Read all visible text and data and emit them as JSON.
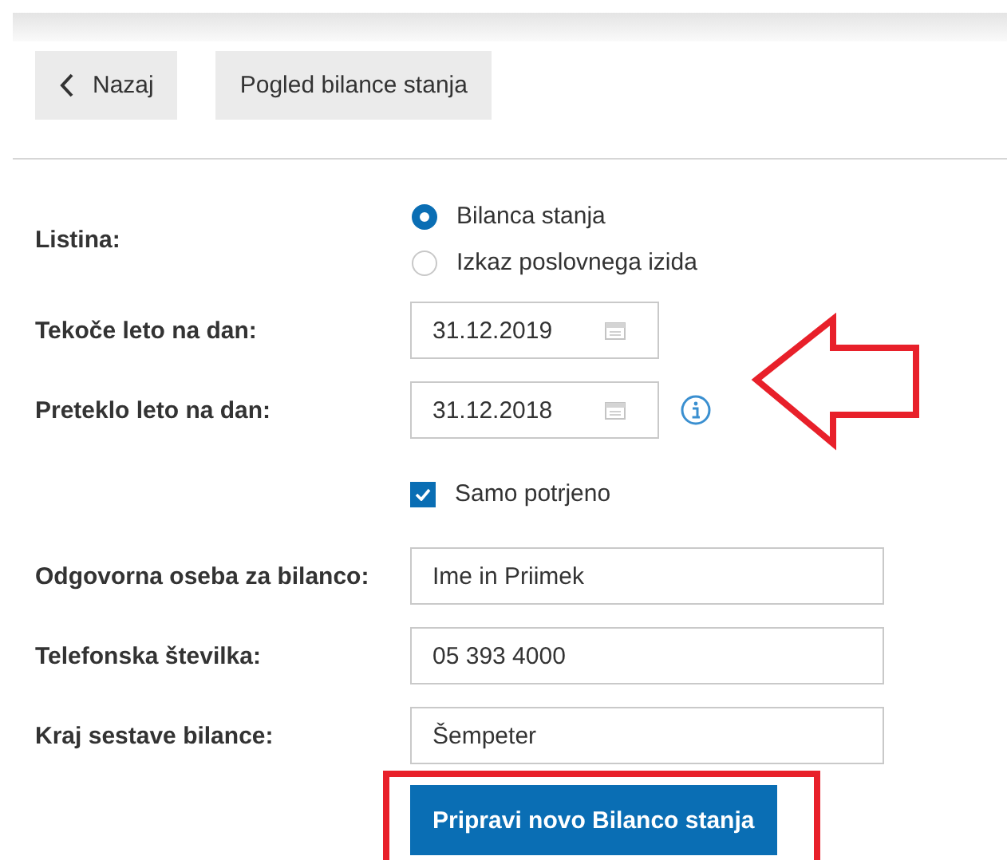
{
  "toolbar": {
    "back_button": {
      "label": "Nazaj"
    },
    "view_button": {
      "label": "Pogled bilance stanja"
    }
  },
  "form": {
    "document": {
      "label": "Listina:",
      "options": [
        {
          "label": "Bilanca stanja",
          "selected": true
        },
        {
          "label": "Izkaz poslovnega izida",
          "selected": false
        }
      ]
    },
    "current_year": {
      "label": "Tekoče leto na dan:",
      "value": "31.12.2019"
    },
    "previous_year": {
      "label": "Preteklo leto na dan:",
      "value": "31.12.2018"
    },
    "only_confirmed": {
      "label": "Samo potrjeno",
      "checked": true
    },
    "text_fields": [
      {
        "label": "Odgovorna oseba za bilanco:",
        "value": "Ime in Priimek"
      },
      {
        "label": "Telefonska številka:",
        "value": "05 393 4000"
      },
      {
        "label": "Kraj sestave bilance:",
        "value": "Šempeter"
      }
    ],
    "submit": {
      "label": "Pripravi novo Bilanco stanja"
    }
  }
}
